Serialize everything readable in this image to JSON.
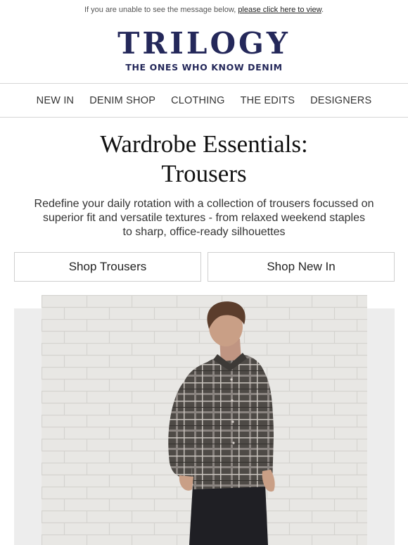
{
  "preheader": {
    "text": "If you are unable to see the message below, ",
    "link_label": "please click here to view",
    "suffix": "."
  },
  "brand": {
    "logo": "TRILOGY",
    "tagline": "THE ONES WHO KNOW DENIM",
    "color": "#24285a"
  },
  "nav": {
    "items": [
      "NEW IN",
      "DENIM SHOP",
      "CLOTHING",
      "THE EDITS",
      "DESIGNERS"
    ]
  },
  "hero_copy": {
    "headline_line1": "Wardrobe Essentials:",
    "headline_line2": "Trousers",
    "body_line1": "Redefine your daily rotation with a collection of trousers focussed on",
    "body_line2": "superior fit and versatile textures - from relaxed weekend staples",
    "body_line3": "to sharp, office-ready silhouettes"
  },
  "cta": {
    "primary_label": "Shop Trousers",
    "secondary_label": "Shop New In"
  },
  "hero_image": {
    "icon": "model-photo",
    "colors": {
      "brick": "#e8e7e4",
      "shirt": "#4e4a46",
      "skin": "#c99f86",
      "hair": "#5b3d2c",
      "trousers": "#1f1f24"
    }
  }
}
